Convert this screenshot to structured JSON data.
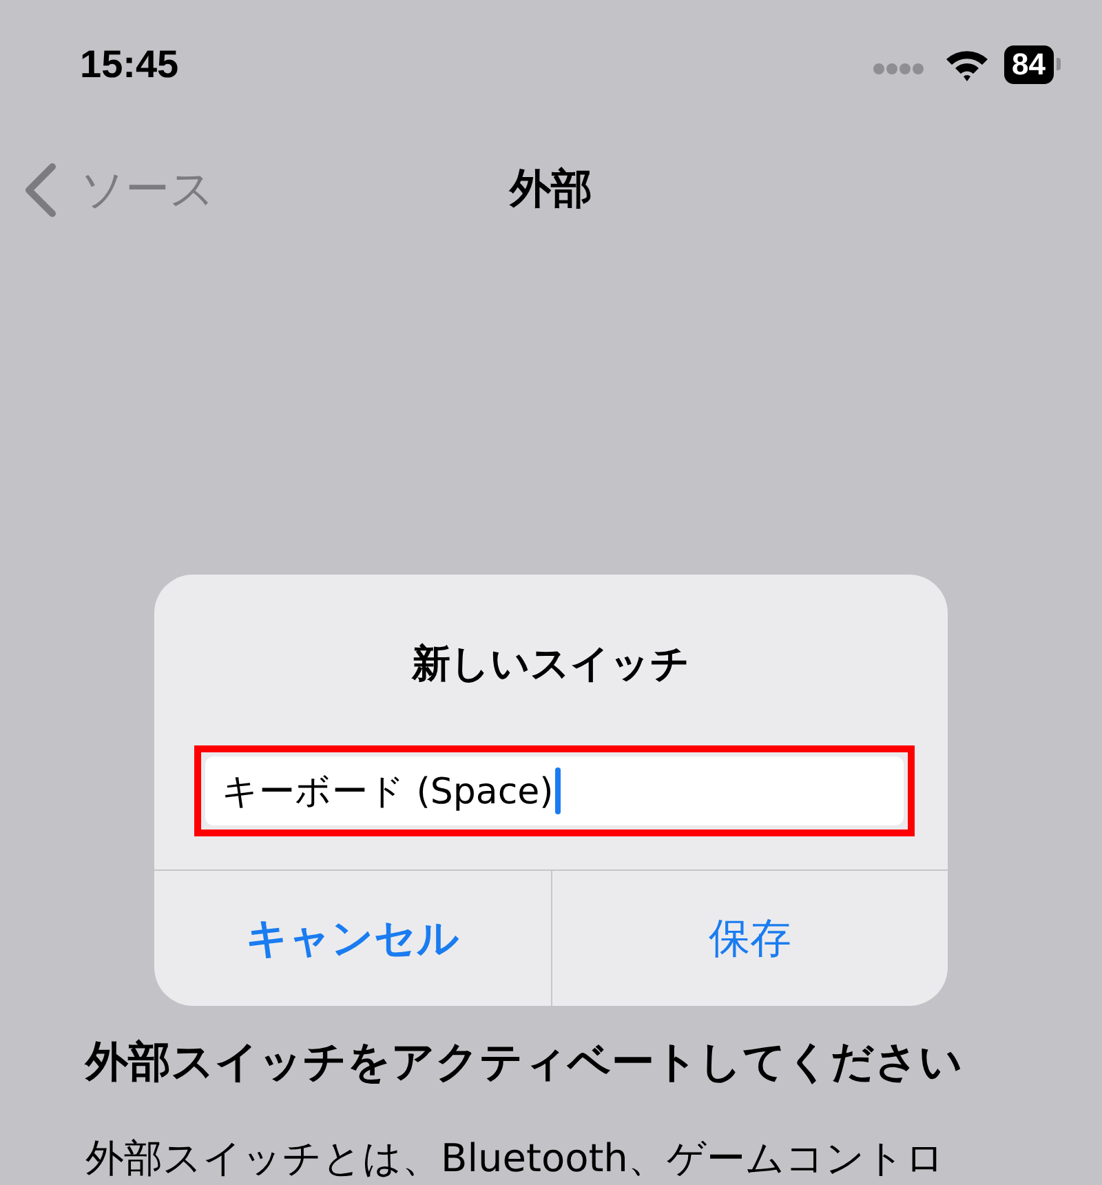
{
  "status_bar": {
    "time": "15:45",
    "battery": "84"
  },
  "nav": {
    "back": "ソース",
    "title": "外部"
  },
  "dialog": {
    "title": "新しいスイッチ",
    "field": {
      "value": "キーボード (Space)",
      "focused": true,
      "highlighted": true
    },
    "buttons": [
      {
        "label": "キャンセル",
        "kind": "preferred"
      },
      {
        "label": "保存",
        "kind": "default"
      }
    ]
  },
  "heading": "外部スイッチをアクティベートしてください",
  "body": "外部スイッチとは、Bluetooth、ゲームコントロ"
}
